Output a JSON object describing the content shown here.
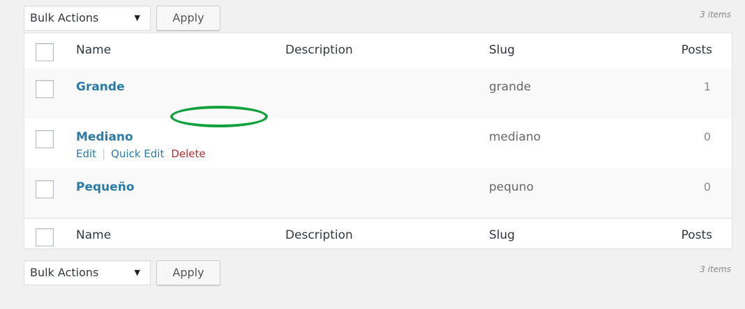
{
  "top_bar": {
    "bulk_actions": "Bulk Actions",
    "apply_label": "Apply",
    "count": "3 items"
  },
  "table": {
    "headers": {
      "name": "Name",
      "description": "Description",
      "slug": "Slug",
      "posts": "Posts"
    },
    "rows": [
      {
        "name": "Grande",
        "slug": "grande",
        "posts": "1"
      },
      {
        "name": "Mediano",
        "slug": "mediano",
        "posts": "0"
      },
      {
        "name": "Pequeño",
        "slug": "pequno",
        "posts": "0"
      }
    ],
    "row_actions": {
      "edit": "Edit",
      "quick_edit": "Quick Edit",
      "delete": "Delete",
      "separator": "|"
    },
    "footers": {
      "name": "Name",
      "description": "Description",
      "slug": "Slug",
      "posts": "Posts"
    }
  },
  "bottom_bar": {
    "bulk_actions": "Bulk Actions",
    "apply_label": "Apply",
    "count": "3 items"
  },
  "colors": {
    "link": "#2a7ba8",
    "delete": "#b32d2e",
    "highlight": "#10a13d"
  },
  "icons": {
    "dropdown": "triangle-down-icon"
  }
}
